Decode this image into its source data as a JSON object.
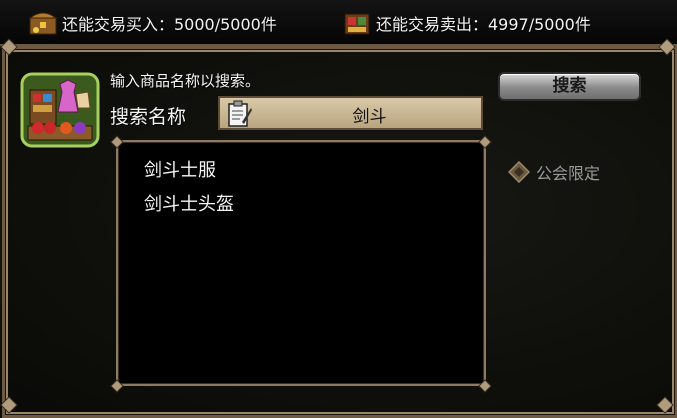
{
  "status": {
    "buy_text": "还能交易买入：5000/5000件",
    "sell_text": "还能交易卖出：4997/5000件"
  },
  "search": {
    "hint": "输入商品名称以搜索。",
    "label": "搜索名称",
    "value": "剑斗",
    "button": "搜索"
  },
  "guild_filter": "公会限定",
  "results": [
    "剑斗士服",
    "剑斗士头盔"
  ],
  "colors": {
    "border": "#6d5a45",
    "field": "#cbb892"
  }
}
